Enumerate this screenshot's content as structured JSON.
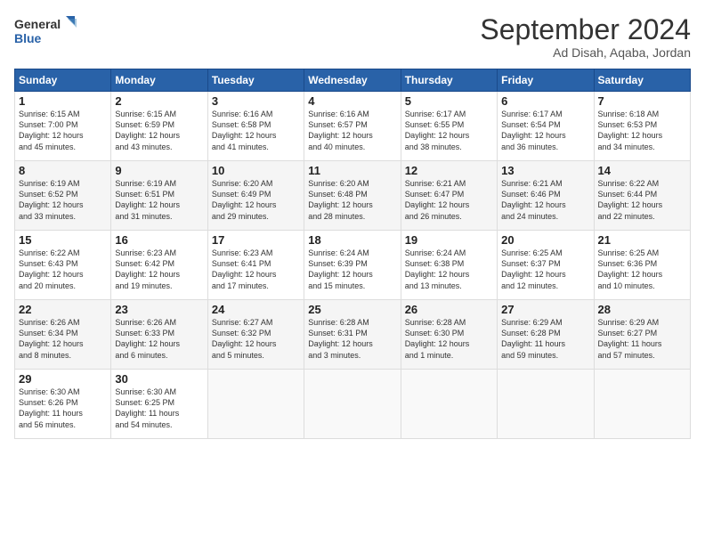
{
  "header": {
    "logo_line1": "General",
    "logo_line2": "Blue",
    "title": "September 2024",
    "location": "Ad Disah, Aqaba, Jordan"
  },
  "weekdays": [
    "Sunday",
    "Monday",
    "Tuesday",
    "Wednesday",
    "Thursday",
    "Friday",
    "Saturday"
  ],
  "weeks": [
    [
      {
        "day": "1",
        "lines": [
          "Sunrise: 6:15 AM",
          "Sunset: 7:00 PM",
          "Daylight: 12 hours",
          "and 45 minutes."
        ]
      },
      {
        "day": "2",
        "lines": [
          "Sunrise: 6:15 AM",
          "Sunset: 6:59 PM",
          "Daylight: 12 hours",
          "and 43 minutes."
        ]
      },
      {
        "day": "3",
        "lines": [
          "Sunrise: 6:16 AM",
          "Sunset: 6:58 PM",
          "Daylight: 12 hours",
          "and 41 minutes."
        ]
      },
      {
        "day": "4",
        "lines": [
          "Sunrise: 6:16 AM",
          "Sunset: 6:57 PM",
          "Daylight: 12 hours",
          "and 40 minutes."
        ]
      },
      {
        "day": "5",
        "lines": [
          "Sunrise: 6:17 AM",
          "Sunset: 6:55 PM",
          "Daylight: 12 hours",
          "and 38 minutes."
        ]
      },
      {
        "day": "6",
        "lines": [
          "Sunrise: 6:17 AM",
          "Sunset: 6:54 PM",
          "Daylight: 12 hours",
          "and 36 minutes."
        ]
      },
      {
        "day": "7",
        "lines": [
          "Sunrise: 6:18 AM",
          "Sunset: 6:53 PM",
          "Daylight: 12 hours",
          "and 34 minutes."
        ]
      }
    ],
    [
      {
        "day": "8",
        "lines": [
          "Sunrise: 6:19 AM",
          "Sunset: 6:52 PM",
          "Daylight: 12 hours",
          "and 33 minutes."
        ]
      },
      {
        "day": "9",
        "lines": [
          "Sunrise: 6:19 AM",
          "Sunset: 6:51 PM",
          "Daylight: 12 hours",
          "and 31 minutes."
        ]
      },
      {
        "day": "10",
        "lines": [
          "Sunrise: 6:20 AM",
          "Sunset: 6:49 PM",
          "Daylight: 12 hours",
          "and 29 minutes."
        ]
      },
      {
        "day": "11",
        "lines": [
          "Sunrise: 6:20 AM",
          "Sunset: 6:48 PM",
          "Daylight: 12 hours",
          "and 28 minutes."
        ]
      },
      {
        "day": "12",
        "lines": [
          "Sunrise: 6:21 AM",
          "Sunset: 6:47 PM",
          "Daylight: 12 hours",
          "and 26 minutes."
        ]
      },
      {
        "day": "13",
        "lines": [
          "Sunrise: 6:21 AM",
          "Sunset: 6:46 PM",
          "Daylight: 12 hours",
          "and 24 minutes."
        ]
      },
      {
        "day": "14",
        "lines": [
          "Sunrise: 6:22 AM",
          "Sunset: 6:44 PM",
          "Daylight: 12 hours",
          "and 22 minutes."
        ]
      }
    ],
    [
      {
        "day": "15",
        "lines": [
          "Sunrise: 6:22 AM",
          "Sunset: 6:43 PM",
          "Daylight: 12 hours",
          "and 20 minutes."
        ]
      },
      {
        "day": "16",
        "lines": [
          "Sunrise: 6:23 AM",
          "Sunset: 6:42 PM",
          "Daylight: 12 hours",
          "and 19 minutes."
        ]
      },
      {
        "day": "17",
        "lines": [
          "Sunrise: 6:23 AM",
          "Sunset: 6:41 PM",
          "Daylight: 12 hours",
          "and 17 minutes."
        ]
      },
      {
        "day": "18",
        "lines": [
          "Sunrise: 6:24 AM",
          "Sunset: 6:39 PM",
          "Daylight: 12 hours",
          "and 15 minutes."
        ]
      },
      {
        "day": "19",
        "lines": [
          "Sunrise: 6:24 AM",
          "Sunset: 6:38 PM",
          "Daylight: 12 hours",
          "and 13 minutes."
        ]
      },
      {
        "day": "20",
        "lines": [
          "Sunrise: 6:25 AM",
          "Sunset: 6:37 PM",
          "Daylight: 12 hours",
          "and 12 minutes."
        ]
      },
      {
        "day": "21",
        "lines": [
          "Sunrise: 6:25 AM",
          "Sunset: 6:36 PM",
          "Daylight: 12 hours",
          "and 10 minutes."
        ]
      }
    ],
    [
      {
        "day": "22",
        "lines": [
          "Sunrise: 6:26 AM",
          "Sunset: 6:34 PM",
          "Daylight: 12 hours",
          "and 8 minutes."
        ]
      },
      {
        "day": "23",
        "lines": [
          "Sunrise: 6:26 AM",
          "Sunset: 6:33 PM",
          "Daylight: 12 hours",
          "and 6 minutes."
        ]
      },
      {
        "day": "24",
        "lines": [
          "Sunrise: 6:27 AM",
          "Sunset: 6:32 PM",
          "Daylight: 12 hours",
          "and 5 minutes."
        ]
      },
      {
        "day": "25",
        "lines": [
          "Sunrise: 6:28 AM",
          "Sunset: 6:31 PM",
          "Daylight: 12 hours",
          "and 3 minutes."
        ]
      },
      {
        "day": "26",
        "lines": [
          "Sunrise: 6:28 AM",
          "Sunset: 6:30 PM",
          "Daylight: 12 hours",
          "and 1 minute."
        ]
      },
      {
        "day": "27",
        "lines": [
          "Sunrise: 6:29 AM",
          "Sunset: 6:28 PM",
          "Daylight: 11 hours",
          "and 59 minutes."
        ]
      },
      {
        "day": "28",
        "lines": [
          "Sunrise: 6:29 AM",
          "Sunset: 6:27 PM",
          "Daylight: 11 hours",
          "and 57 minutes."
        ]
      }
    ],
    [
      {
        "day": "29",
        "lines": [
          "Sunrise: 6:30 AM",
          "Sunset: 6:26 PM",
          "Daylight: 11 hours",
          "and 56 minutes."
        ]
      },
      {
        "day": "30",
        "lines": [
          "Sunrise: 6:30 AM",
          "Sunset: 6:25 PM",
          "Daylight: 11 hours",
          "and 54 minutes."
        ]
      },
      null,
      null,
      null,
      null,
      null
    ]
  ]
}
